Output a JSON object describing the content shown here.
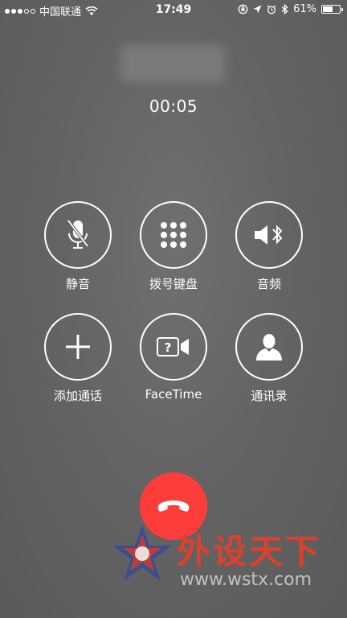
{
  "status_bar": {
    "carrier": "中国联通",
    "time": "17:49",
    "battery": "61%",
    "battery_level": 0.61
  },
  "call": {
    "duration": "00:05"
  },
  "buttons": [
    {
      "label": "静音",
      "icon": "mic-off-icon"
    },
    {
      "label": "拨号键盘",
      "icon": "keypad-icon"
    },
    {
      "label": "音频",
      "icon": "speaker-bluetooth-icon"
    },
    {
      "label": "添加通话",
      "icon": "plus-icon"
    },
    {
      "label": "FaceTime",
      "icon": "facetime-icon"
    },
    {
      "label": "通讯录",
      "icon": "contact-icon"
    }
  ],
  "end_call": {
    "icon": "phone-hangup-icon",
    "color": "#fc3d39"
  },
  "watermark": {
    "logo": "外设天下",
    "url": "www.wstx.com",
    "color": "#e0402a"
  }
}
